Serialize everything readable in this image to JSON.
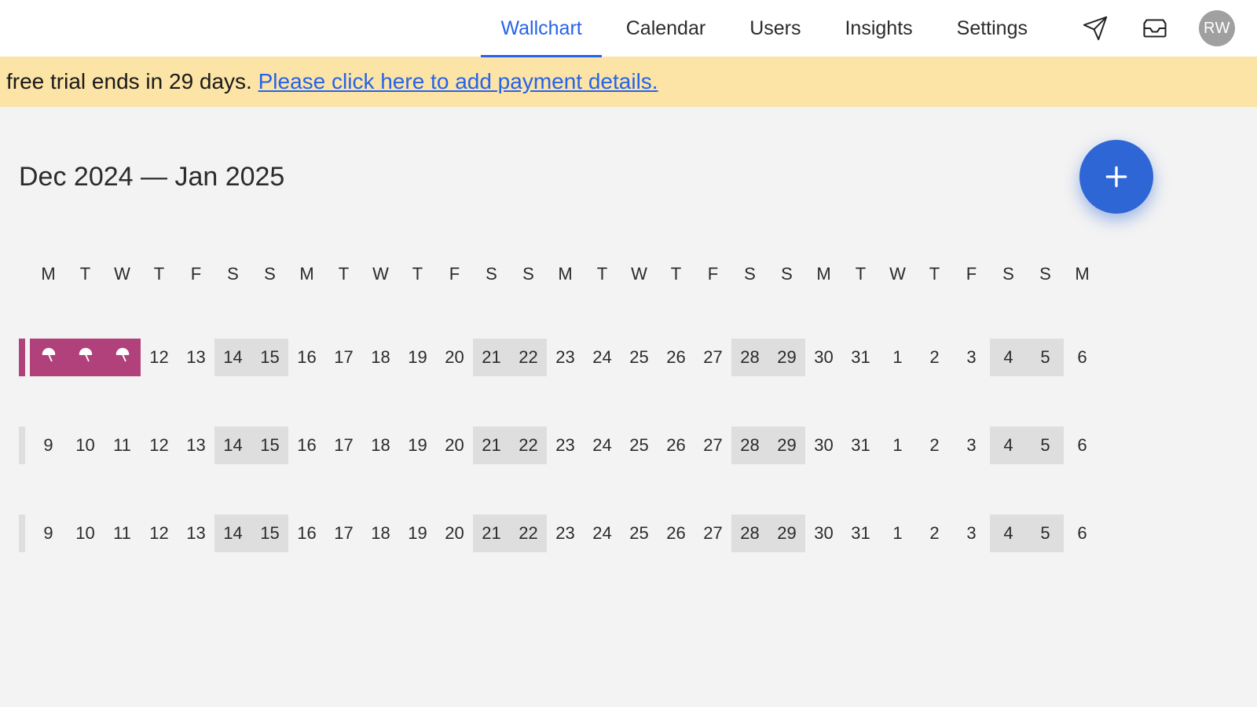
{
  "nav": {
    "items": [
      {
        "label": "Wallchart",
        "active": true
      },
      {
        "label": "Calendar",
        "active": false
      },
      {
        "label": "Users",
        "active": false
      },
      {
        "label": "Insights",
        "active": false
      },
      {
        "label": "Settings",
        "active": false
      }
    ]
  },
  "avatar": {
    "initials": "RW"
  },
  "banner": {
    "text_before": "free trial ends in 29 days. ",
    "link_text": "Please click here to add payment details."
  },
  "range_title": "Dec 2024 — Jan 2025",
  "day_headers": [
    "M",
    "T",
    "W",
    "T",
    "F",
    "S",
    "S",
    "M",
    "T",
    "W",
    "T",
    "F",
    "S",
    "S",
    "M",
    "T",
    "W",
    "T",
    "F",
    "S",
    "S",
    "M",
    "T",
    "W",
    "T",
    "F",
    "S",
    "S",
    "M"
  ],
  "rows": [
    {
      "cells": [
        {
          "booked": true
        },
        {
          "booked": true
        },
        {
          "booked": true
        },
        {
          "day": "12"
        },
        {
          "day": "13"
        },
        {
          "day": "14",
          "weekend": true
        },
        {
          "day": "15",
          "weekend": true
        },
        {
          "day": "16"
        },
        {
          "day": "17"
        },
        {
          "day": "18"
        },
        {
          "day": "19"
        },
        {
          "day": "20"
        },
        {
          "day": "21",
          "weekend": true
        },
        {
          "day": "22",
          "weekend": true
        },
        {
          "day": "23"
        },
        {
          "day": "24"
        },
        {
          "day": "25"
        },
        {
          "day": "26"
        },
        {
          "day": "27"
        },
        {
          "day": "28",
          "weekend": true
        },
        {
          "day": "29",
          "weekend": true
        },
        {
          "day": "30"
        },
        {
          "day": "31"
        },
        {
          "day": "1"
        },
        {
          "day": "2"
        },
        {
          "day": "3"
        },
        {
          "day": "4",
          "weekend": true
        },
        {
          "day": "5",
          "weekend": true
        },
        {
          "day": "6"
        }
      ]
    },
    {
      "cells": [
        {
          "day": "9"
        },
        {
          "day": "10"
        },
        {
          "day": "11"
        },
        {
          "day": "12"
        },
        {
          "day": "13"
        },
        {
          "day": "14",
          "weekend": true
        },
        {
          "day": "15",
          "weekend": true
        },
        {
          "day": "16"
        },
        {
          "day": "17"
        },
        {
          "day": "18"
        },
        {
          "day": "19"
        },
        {
          "day": "20"
        },
        {
          "day": "21",
          "weekend": true
        },
        {
          "day": "22",
          "weekend": true
        },
        {
          "day": "23"
        },
        {
          "day": "24"
        },
        {
          "day": "25"
        },
        {
          "day": "26"
        },
        {
          "day": "27"
        },
        {
          "day": "28",
          "weekend": true
        },
        {
          "day": "29",
          "weekend": true
        },
        {
          "day": "30"
        },
        {
          "day": "31"
        },
        {
          "day": "1"
        },
        {
          "day": "2"
        },
        {
          "day": "3"
        },
        {
          "day": "4",
          "weekend": true
        },
        {
          "day": "5",
          "weekend": true
        },
        {
          "day": "6"
        }
      ]
    },
    {
      "cells": [
        {
          "day": "9"
        },
        {
          "day": "10"
        },
        {
          "day": "11"
        },
        {
          "day": "12"
        },
        {
          "day": "13"
        },
        {
          "day": "14",
          "weekend": true
        },
        {
          "day": "15",
          "weekend": true
        },
        {
          "day": "16"
        },
        {
          "day": "17"
        },
        {
          "day": "18"
        },
        {
          "day": "19"
        },
        {
          "day": "20"
        },
        {
          "day": "21",
          "weekend": true
        },
        {
          "day": "22",
          "weekend": true
        },
        {
          "day": "23"
        },
        {
          "day": "24"
        },
        {
          "day": "25"
        },
        {
          "day": "26"
        },
        {
          "day": "27"
        },
        {
          "day": "28",
          "weekend": true
        },
        {
          "day": "29",
          "weekend": true
        },
        {
          "day": "30"
        },
        {
          "day": "31"
        },
        {
          "day": "1"
        },
        {
          "day": "2"
        },
        {
          "day": "3"
        },
        {
          "day": "4",
          "weekend": true
        },
        {
          "day": "5",
          "weekend": true
        },
        {
          "day": "6"
        }
      ]
    }
  ]
}
